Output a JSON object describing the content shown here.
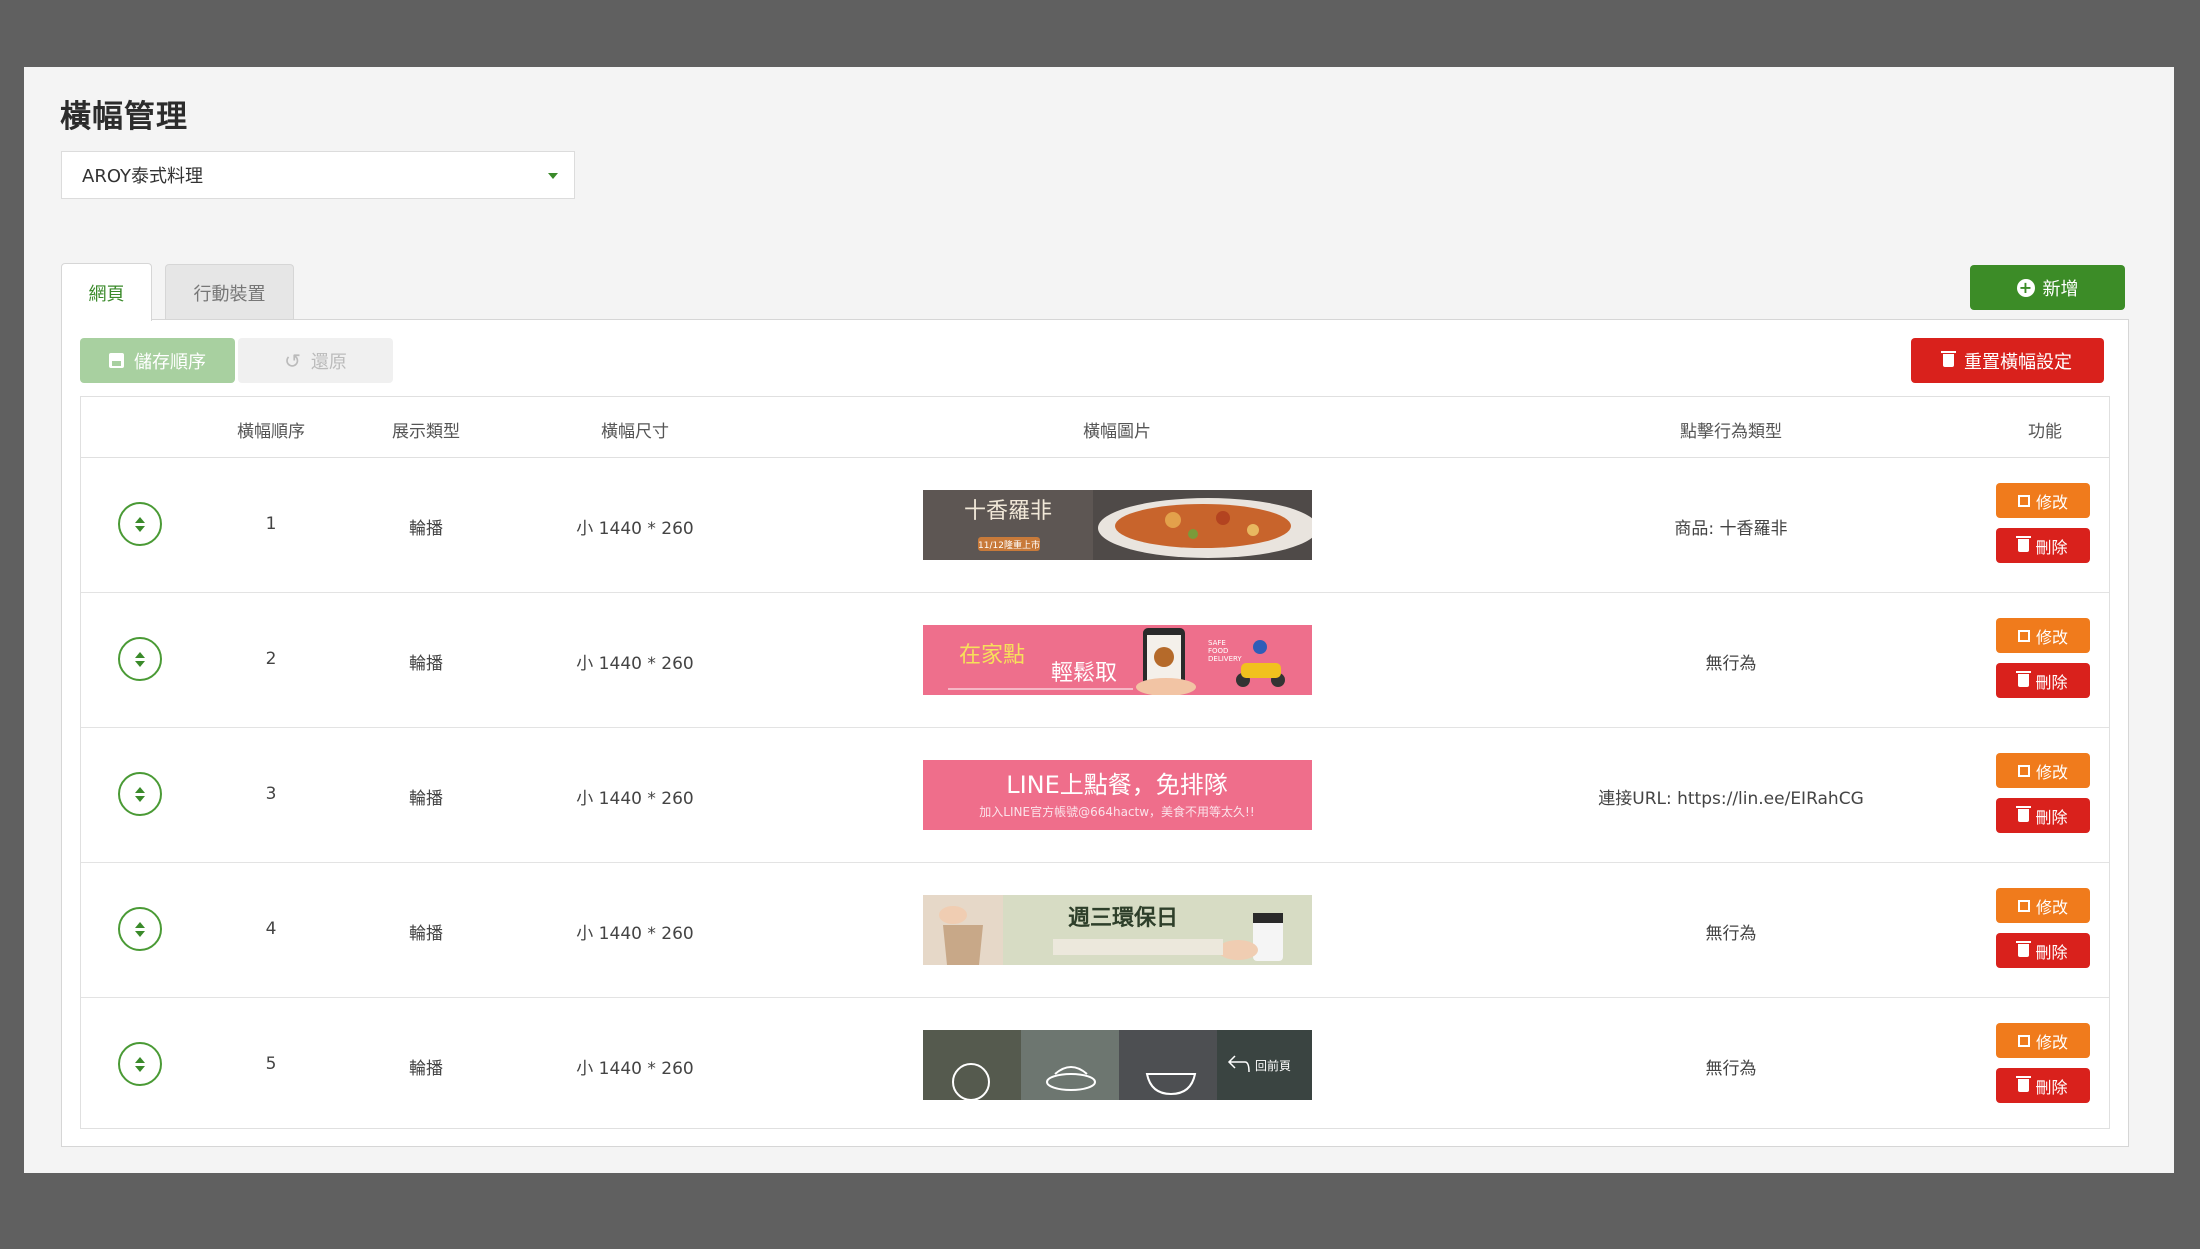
{
  "page": {
    "title": "橫幅管理",
    "store_select": {
      "value": "AROY泰式料理"
    }
  },
  "tabs": [
    {
      "label": "網頁",
      "active": true
    },
    {
      "label": "行動裝置",
      "active": false
    }
  ],
  "toolbar": {
    "add_label": "新增",
    "save_order_label": "儲存順序",
    "restore_label": "還原",
    "reset_label": "重置橫幅設定"
  },
  "table": {
    "headers": [
      "橫幅順序",
      "展示類型",
      "橫幅尺寸",
      "橫幅圖片",
      "點擊行為類型",
      "功能"
    ],
    "rows": [
      {
        "order": "1",
        "display_type": "輪播",
        "size": "小 1440 * 260",
        "action": "商品: 十香羅非",
        "banner": {
          "theme": "fish",
          "headline": "十香羅非",
          "subline": "11/12隆重上市"
        }
      },
      {
        "order": "2",
        "display_type": "輪播",
        "size": "小 1440 * 260",
        "action": "無行為",
        "banner": {
          "theme": "delivery",
          "headline": "在家點",
          "subline": "輕鬆取"
        }
      },
      {
        "order": "3",
        "display_type": "輪播",
        "size": "小 1440 * 260",
        "action": "連接URL: https://lin.ee/EIRahCG",
        "banner": {
          "theme": "line",
          "headline": "LINE上點餐，免排隊",
          "subline": "加入LINE官方帳號@664hactw，美食不用等太久!!"
        }
      },
      {
        "order": "4",
        "display_type": "輪播",
        "size": "小 1440 * 260",
        "action": "無行為",
        "banner": {
          "theme": "eco",
          "headline": "週三環保日",
          "subline": ""
        }
      },
      {
        "order": "5",
        "display_type": "輪播",
        "size": "小 1440 * 260",
        "action": "無行為",
        "banner": {
          "theme": "menu",
          "headline": "回前頁",
          "subline": ""
        }
      }
    ],
    "row_actions": {
      "edit_label": "修改",
      "delete_label": "刪除"
    }
  },
  "colors": {
    "brand_green": "#3c8c27",
    "danger_red": "#d9211c",
    "edit_orange": "#f07b1c"
  }
}
